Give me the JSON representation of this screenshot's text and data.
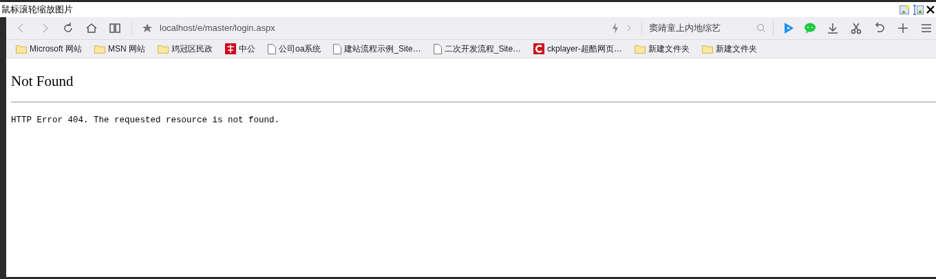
{
  "window": {
    "title": "鼠标滚轮缩放图片"
  },
  "toolbar": {
    "address": "localhost/e/master/login.aspx",
    "search": "窦靖童上内地综艺"
  },
  "bookmarks": [
    {
      "kind": "folder",
      "label": "Microsoft 网站"
    },
    {
      "kind": "folder",
      "label": "MSN 网站"
    },
    {
      "kind": "folder",
      "label": "鸡冠区民政"
    },
    {
      "kind": "app",
      "label": "中公"
    },
    {
      "kind": "page",
      "label": "公司oa系统"
    },
    {
      "kind": "page",
      "label": "建站流程示例_Site…"
    },
    {
      "kind": "page",
      "label": "二次开发流程_Site…"
    },
    {
      "kind": "player",
      "label": "ckplayer-超酷网页…"
    },
    {
      "kind": "folder",
      "label": "新建文件夹"
    },
    {
      "kind": "folder",
      "label": "新建文件夹"
    }
  ],
  "page": {
    "heading": "Not Found",
    "message": "HTTP Error 404. The requested resource is not found."
  }
}
